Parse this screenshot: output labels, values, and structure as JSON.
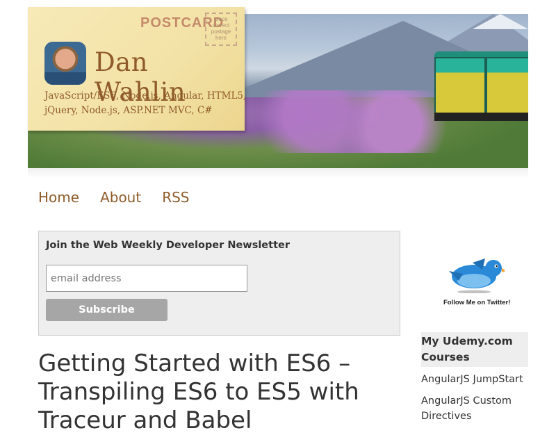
{
  "header": {
    "postcard_word": "POSTCARD",
    "stamp_text": [
      "place",
      "correct",
      "postage",
      "here"
    ],
    "author_name": "Dan Wahlin",
    "tagline": "JavaScript/ES6, Node.js, Angular, HTML5, jQuery, Node.js, ASP.NET MVC, C#"
  },
  "nav": {
    "items": [
      {
        "label": "Home"
      },
      {
        "label": "About"
      },
      {
        "label": "RSS"
      }
    ]
  },
  "newsletter": {
    "title": "Join the Web Weekly Developer Newsletter",
    "email_placeholder": "email address",
    "subscribe_label": "Subscribe"
  },
  "post": {
    "title": "Getting Started with ES6 – Transpiling ES6 to ES5 with Traceur and Babel"
  },
  "sidebar": {
    "twitter_caption": "Follow Me on Twitter!",
    "udemy_heading": [
      "My Udemy.com",
      "Courses"
    ],
    "udemy_links": [
      {
        "label": "AngularJS JumpStart"
      },
      {
        "label": "AngularJS Custom Directives"
      }
    ]
  },
  "colors": {
    "accent": "#8f5b2a",
    "postcard_bg": "#f3e2a6",
    "button_bg": "#a6a6a6",
    "twitter_blue": "#2a8ad8"
  }
}
